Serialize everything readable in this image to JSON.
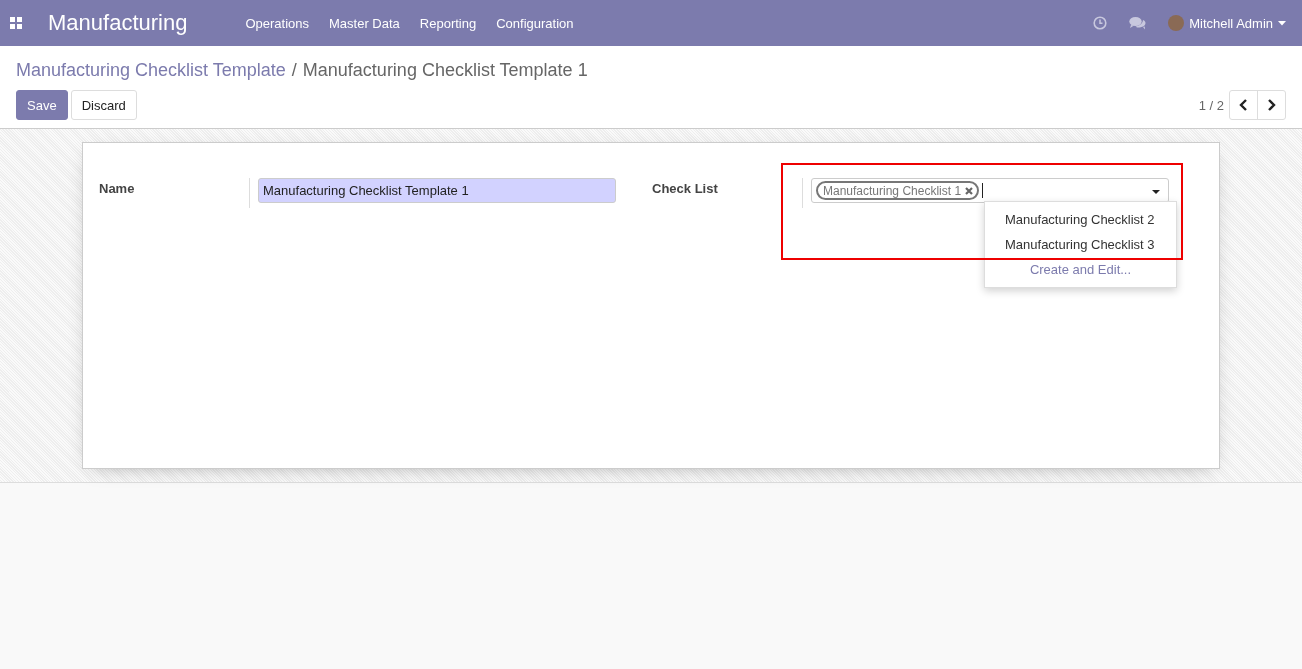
{
  "navbar": {
    "app_title": "Manufacturing",
    "menu": [
      "Operations",
      "Master Data",
      "Reporting",
      "Configuration"
    ],
    "user": "Mitchell Admin"
  },
  "breadcrumbs": [
    {
      "label": "Manufacturing Checklist Template",
      "kind": "link"
    },
    {
      "label": "Manufacturing Checklist Template 1",
      "kind": "current"
    }
  ],
  "breadcrumb_separator": "/",
  "buttons": [
    {
      "label": "Save",
      "kind": "primary"
    },
    {
      "label": "Discard",
      "kind": "secondary"
    }
  ],
  "pager": "1 / 2",
  "form": {
    "fields": [
      {
        "label": "Name",
        "kind": "text",
        "value": "Manufacturing Checklist Template 1",
        "highlighted": false
      },
      {
        "label": "Check List",
        "kind": "tags",
        "tags": [
          "Manufacturing Checklist 1"
        ],
        "highlighted": true,
        "dropdown": {
          "options": [
            "Manufacturing Checklist 2",
            "Manufacturing Checklist 3"
          ],
          "create": "Create and Edit..."
        }
      }
    ]
  }
}
